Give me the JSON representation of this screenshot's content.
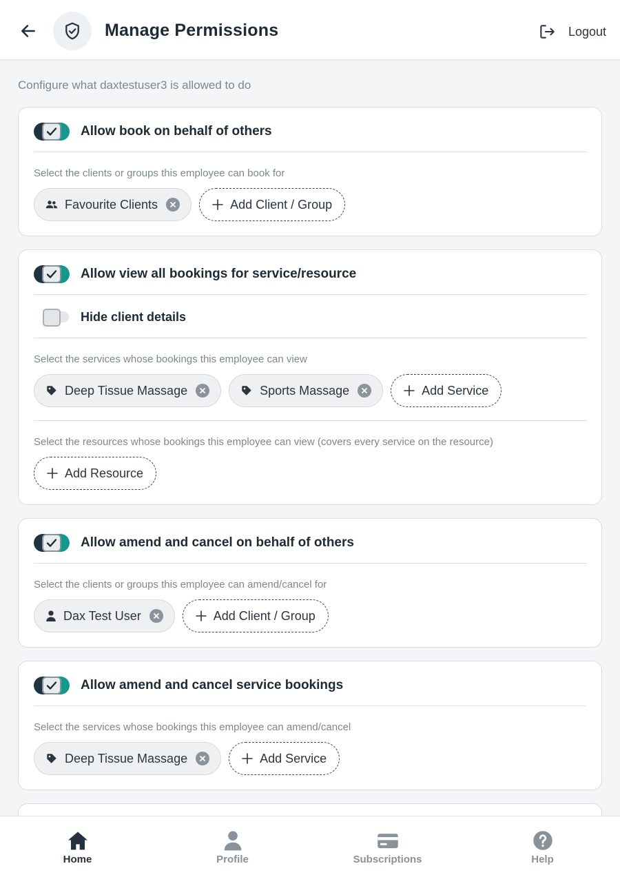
{
  "header": {
    "title": "Manage Permissions",
    "logout_label": "Logout"
  },
  "subtitle": "Configure what daxtestuser3 is allowed to do",
  "cards": [
    {
      "title": "Allow book on behalf of others",
      "enabled": true,
      "hint": "Select the clients or groups this employee can book for",
      "chips": [
        {
          "icon": "group-icon",
          "label": "Favourite Clients"
        }
      ],
      "add_label": "Add Client / Group"
    },
    {
      "title": "Allow view all bookings for service/resource",
      "enabled": true,
      "sub_option": {
        "title": "Hide client details",
        "enabled": false
      },
      "service_hint": "Select the services whose bookings this employee can view",
      "service_chips": [
        {
          "icon": "tag-icon",
          "label": "Deep Tissue Massage"
        },
        {
          "icon": "tag-icon",
          "label": "Sports Massage"
        }
      ],
      "add_service_label": "Add Service",
      "resource_hint": "Select the resources whose bookings this employee can view (covers every service on the resource)",
      "add_resource_label": "Add Resource"
    },
    {
      "title": "Allow amend and cancel on behalf of others",
      "enabled": true,
      "hint": "Select the clients or groups this employee can amend/cancel for",
      "chips": [
        {
          "icon": "person-icon",
          "label": "Dax Test User"
        }
      ],
      "add_label": "Add Client / Group"
    },
    {
      "title": "Allow amend and cancel service bookings",
      "enabled": true,
      "hint": "Select the services whose bookings this employee can amend/cancel",
      "chips": [
        {
          "icon": "tag-icon",
          "label": "Deep Tissue Massage"
        }
      ],
      "add_label": "Add Service"
    }
  ],
  "bottom_nav": [
    {
      "label": "Home",
      "icon": "home-icon",
      "active": true
    },
    {
      "label": "Profile",
      "icon": "profile-icon",
      "active": false
    },
    {
      "label": "Subscriptions",
      "icon": "card-icon",
      "active": false
    },
    {
      "label": "Help",
      "icon": "help-icon",
      "active": false
    }
  ],
  "colors": {
    "accent": "#12998b",
    "toggle_dark": "#1f3340",
    "background": "#f3f5f7"
  }
}
